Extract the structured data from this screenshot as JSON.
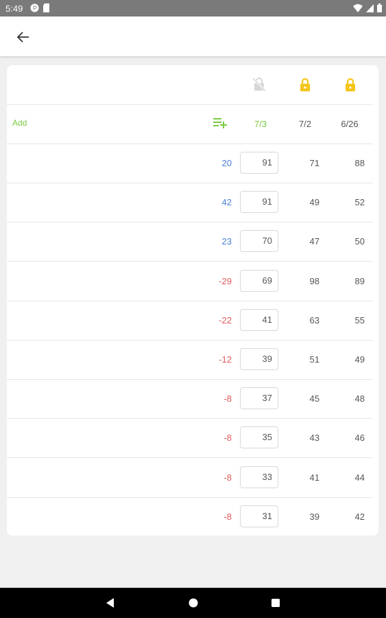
{
  "status_bar": {
    "time": "5:49",
    "left_icons": [
      "pocket-icon",
      "sd-card-icon"
    ],
    "right_icons": [
      "wifi-icon",
      "signal-icon",
      "battery-icon"
    ]
  },
  "app_bar": {
    "back_icon": "arrow-back-icon"
  },
  "colors": {
    "accent": "#7ac943",
    "positive": "#4a7fd4",
    "negative": "#e05a5a",
    "lock_gold": "#f5c518",
    "lock_grey": "#cccccc"
  },
  "table": {
    "lock_states": [
      "unlocked-disabled",
      "locked",
      "locked"
    ],
    "add_label": "Add",
    "add_icon": "playlist-add-icon",
    "dates": [
      "7/3",
      "7/2",
      "6/26"
    ],
    "rows": [
      {
        "diff": "20",
        "current": "91",
        "prev1": "71",
        "prev2": "88",
        "trend": "pos"
      },
      {
        "diff": "42",
        "current": "91",
        "prev1": "49",
        "prev2": "52",
        "trend": "pos"
      },
      {
        "diff": "23",
        "current": "70",
        "prev1": "47",
        "prev2": "50",
        "trend": "pos"
      },
      {
        "diff": "-29",
        "current": "69",
        "prev1": "98",
        "prev2": "89",
        "trend": "neg"
      },
      {
        "diff": "-22",
        "current": "41",
        "prev1": "63",
        "prev2": "55",
        "trend": "neg"
      },
      {
        "diff": "-12",
        "current": "39",
        "prev1": "51",
        "prev2": "49",
        "trend": "neg"
      },
      {
        "diff": "-8",
        "current": "37",
        "prev1": "45",
        "prev2": "48",
        "trend": "neg"
      },
      {
        "diff": "-8",
        "current": "35",
        "prev1": "43",
        "prev2": "46",
        "trend": "neg"
      },
      {
        "diff": "-8",
        "current": "33",
        "prev1": "41",
        "prev2": "44",
        "trend": "neg"
      },
      {
        "diff": "-8",
        "current": "31",
        "prev1": "39",
        "prev2": "42",
        "trend": "neg"
      }
    ]
  },
  "nav_bar": {
    "icons": [
      "nav-back-icon",
      "nav-home-icon",
      "nav-recents-icon"
    ]
  }
}
